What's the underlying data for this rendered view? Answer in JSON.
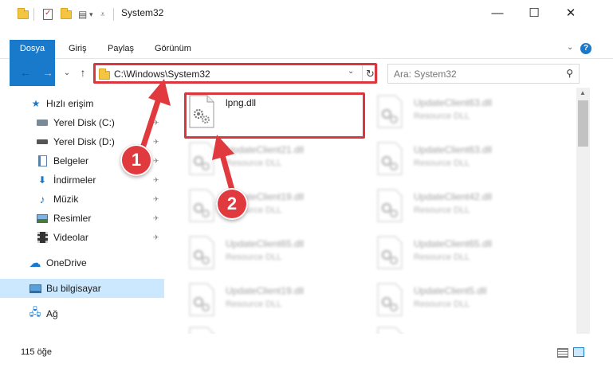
{
  "window": {
    "title": "System32",
    "quick_access_dropdown": "▾",
    "minimize": "—",
    "maximize": "☐",
    "close": "✕"
  },
  "ribbon": {
    "tabs": [
      {
        "label": "Dosya"
      },
      {
        "label": "Giriş"
      },
      {
        "label": "Paylaş"
      },
      {
        "label": "Görünüm"
      }
    ],
    "collapse": "⌄",
    "help": "?"
  },
  "nav": {
    "back": "←",
    "forward": "→",
    "recent": "⌄",
    "up": "↑"
  },
  "address": {
    "path": "C:\\Windows\\System32",
    "dropdown": "⌄",
    "refresh": "↻"
  },
  "search": {
    "placeholder": "Ara: System32",
    "icon": "search-icon"
  },
  "sidebar": {
    "items": [
      {
        "label": "Hızlı erişim",
        "icon": "star-icon",
        "pinned": false
      },
      {
        "label": "Yerel Disk (C:)",
        "icon": "drive-icon",
        "pinned": true
      },
      {
        "label": "Yerel Disk (D:)",
        "icon": "drive-icon",
        "pinned": true
      },
      {
        "label": "Belgeler",
        "icon": "documents-icon",
        "pinned": true
      },
      {
        "label": "İndirmeler",
        "icon": "download-icon",
        "pinned": true
      },
      {
        "label": "Müzik",
        "icon": "music-icon",
        "pinned": true
      },
      {
        "label": "Resimler",
        "icon": "pictures-icon",
        "pinned": true
      },
      {
        "label": "Videolar",
        "icon": "videos-icon",
        "pinned": true
      },
      {
        "label": "OneDrive",
        "icon": "cloud-icon",
        "pinned": false
      },
      {
        "label": "Bu bilgisayar",
        "icon": "computer-icon",
        "pinned": false,
        "selected": true
      },
      {
        "label": "Ağ",
        "icon": "network-icon",
        "pinned": false
      }
    ],
    "pin_glyph": "📌"
  },
  "files": [
    {
      "name": "lpng.dll",
      "desc": "",
      "clear": true
    },
    {
      "name": "UpdateClient63.dll",
      "desc": "Resource DLL"
    },
    {
      "name": "UpdateClient21.dll",
      "desc": "Resource DLL"
    },
    {
      "name": "UpdateClient63.dll",
      "desc": "Resource DLL"
    },
    {
      "name": "UpdateClient19.dll",
      "desc": "Resource DLL"
    },
    {
      "name": "UpdateClient42.dll",
      "desc": "Resource DLL"
    },
    {
      "name": "UpdateClient65.dll",
      "desc": "Resource DLL"
    },
    {
      "name": "UpdateClient65.dll",
      "desc": "Resource DLL"
    },
    {
      "name": "UpdateClient19.dll",
      "desc": "Resource DLL"
    },
    {
      "name": "UpdateClient5.dll",
      "desc": "Resource DLL"
    },
    {
      "name": "",
      "desc": ""
    },
    {
      "name": "",
      "desc": ""
    }
  ],
  "status": {
    "count": "115 öğe"
  },
  "callouts": [
    {
      "number": "1"
    },
    {
      "number": "2"
    }
  ],
  "colors": {
    "accent": "#1979ca",
    "highlight": "#d9363e",
    "callout": "#e0393e",
    "selected": "#cce8ff"
  }
}
